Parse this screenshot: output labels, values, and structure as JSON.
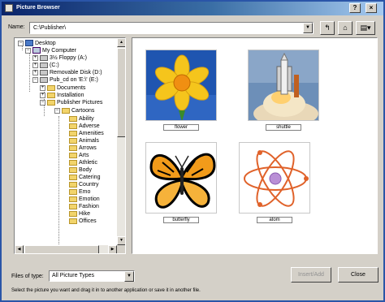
{
  "window": {
    "title": "Picture Browser"
  },
  "lookin": {
    "label": "Name:",
    "value": "C:\\Publisher\\"
  },
  "toolbar": {
    "back_icon": "up-folder-icon",
    "home_icon": "home-icon",
    "views_icon": "views-icon"
  },
  "tree": {
    "items": [
      {
        "label": "Desktop",
        "icon": "desktop-icon"
      },
      {
        "label": "My Computer",
        "icon": "computer-icon"
      },
      {
        "label": "3½ Floppy (A:)",
        "icon": "floppy-icon"
      },
      {
        "label": "(C:)",
        "icon": "drive-icon"
      },
      {
        "label": "Removable Disk (D:)",
        "icon": "drive-icon"
      },
      {
        "label": "Pub_cd on 'E:\\' (E:)",
        "icon": "cd-icon"
      },
      {
        "label": "Documents",
        "icon": "folder-icon"
      },
      {
        "label": "Installation",
        "icon": "folder-icon"
      },
      {
        "label": "Publisher Pictures",
        "icon": "folder-icon"
      },
      {
        "label": "Cartoons",
        "icon": "folder-icon"
      },
      {
        "label": "Ability",
        "icon": "folder-icon"
      },
      {
        "label": "Adverse",
        "icon": "folder-icon"
      },
      {
        "label": "Amenities",
        "icon": "folder-icon"
      },
      {
        "label": "Animals",
        "icon": "folder-icon"
      },
      {
        "label": "Arrows",
        "icon": "folder-icon"
      },
      {
        "label": "Arts",
        "icon": "folder-icon"
      },
      {
        "label": "Athletic",
        "icon": "folder-icon"
      },
      {
        "label": "Body",
        "icon": "folder-icon"
      },
      {
        "label": "Catering",
        "icon": "folder-icon"
      },
      {
        "label": "Country",
        "icon": "folder-icon"
      },
      {
        "label": "Emo",
        "icon": "folder-icon"
      },
      {
        "label": "Emotion",
        "icon": "folder-icon"
      },
      {
        "label": "Fashion",
        "icon": "folder-icon"
      },
      {
        "label": "Hike",
        "icon": "folder-icon"
      },
      {
        "label": "Offices",
        "icon": "folder-icon"
      }
    ]
  },
  "pictures": [
    {
      "label": "flower",
      "kind": "daffodil"
    },
    {
      "label": "shuttle",
      "kind": "shuttle-launch"
    },
    {
      "label": "butterfly",
      "kind": "butterfly"
    },
    {
      "label": "atom",
      "kind": "atom"
    }
  ],
  "filetype": {
    "label": "Files of type:",
    "value": "All Picture Types"
  },
  "buttons": {
    "insert": "Insert/Add",
    "close": "Close"
  },
  "status": "Select the picture you want and drag it in to another application or save it in another file."
}
